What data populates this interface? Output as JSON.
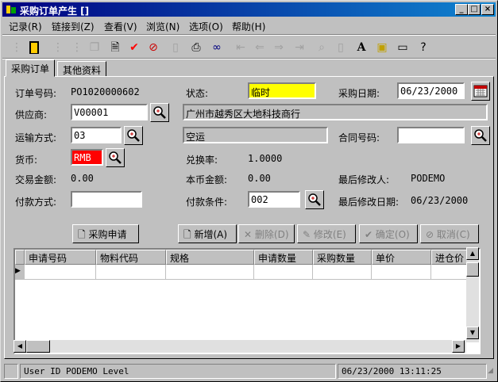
{
  "window": {
    "title": "采购订单产生 []"
  },
  "menu": [
    "记录(R)",
    "链接到(Z)",
    "查看(V)",
    "浏览(N)",
    "选项(O)",
    "帮助(H)"
  ],
  "tabs": [
    "采购订单",
    "其他资料"
  ],
  "form": {
    "order_no_label": "订单号码:",
    "order_no": "PO1020000602",
    "status_label": "状态:",
    "status": "临时",
    "purchase_date_label": "采购日期:",
    "purchase_date": "06/23/2000",
    "supplier_label": "供应商:",
    "supplier_code": "V00001",
    "supplier_name": "广州市越秀区大地科技商行",
    "shipping_label": "运输方式:",
    "shipping_code": "03",
    "shipping_name": "空运",
    "contract_label": "合同号码:",
    "contract_no": "",
    "currency_label": "货币:",
    "currency": "RMB",
    "exchange_label": "兑换率:",
    "exchange_rate": "1.0000",
    "trade_amount_label": "交易金额:",
    "trade_amount": "0.00",
    "local_amount_label": "本币金额:",
    "local_amount": "0.00",
    "last_modifier_label": "最后修改人:",
    "last_modifier": "PODEMO",
    "payment_method_label": "付款方式:",
    "payment_method": "",
    "payment_terms_label": "付款条件:",
    "payment_terms": "002",
    "last_modified_label": "最后修改日期:",
    "last_modified": "06/23/2000"
  },
  "buttons": {
    "request": "采购申请",
    "add": "新增(A)",
    "delete": "删除(D)",
    "modify": "修改(E)",
    "confirm": "确定(O)",
    "cancel": "取消(C)"
  },
  "grid": {
    "columns": [
      "申请号码",
      "物料代码",
      "规格",
      "申请数量",
      "采购数量",
      "单价",
      "进仓价"
    ]
  },
  "status": {
    "user": "User ID PODEMO Level",
    "datetime": "06/23/2000 13:11:25"
  },
  "colors": {
    "titlebar": "#000080",
    "status_field": "#ffff00",
    "currency_field": "#ff0000"
  }
}
